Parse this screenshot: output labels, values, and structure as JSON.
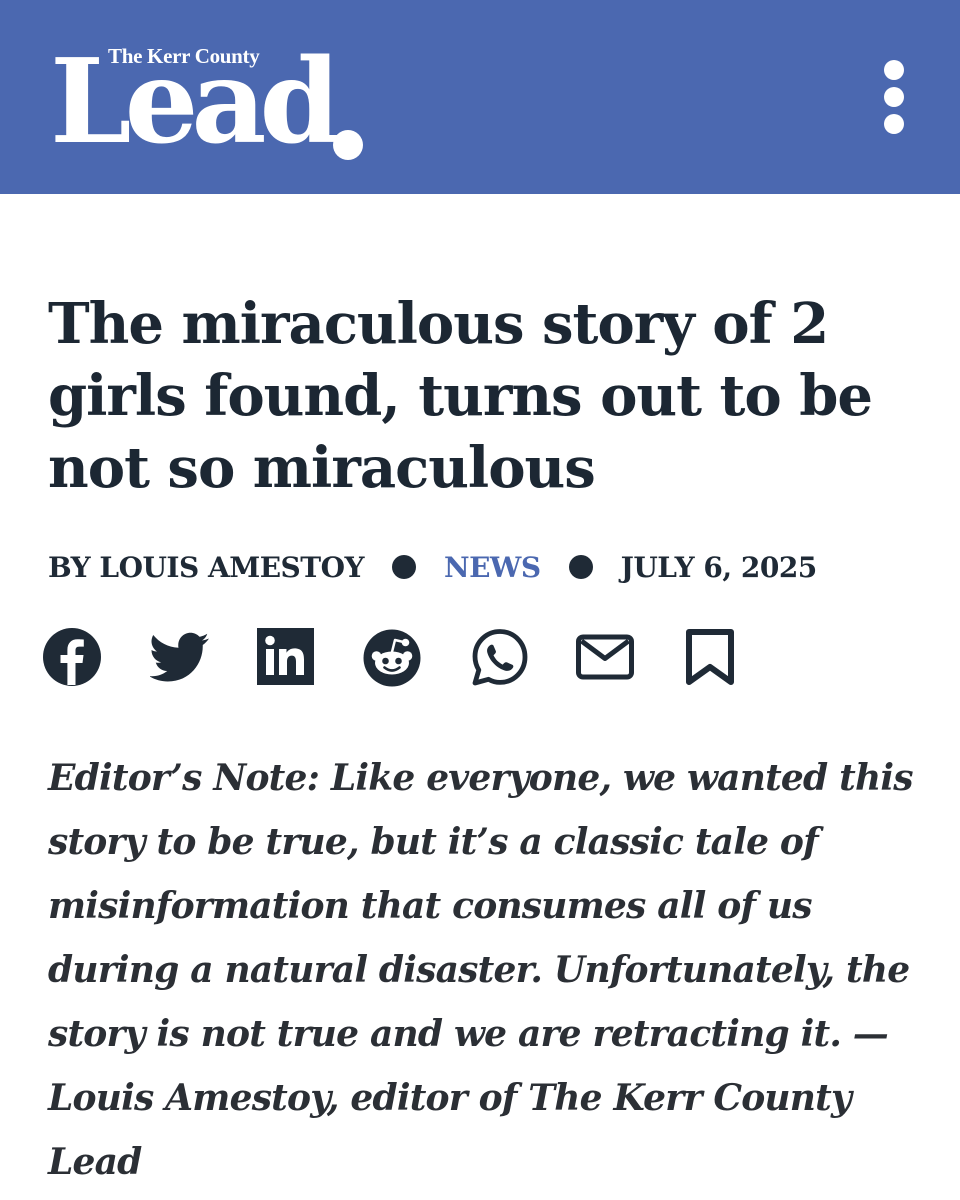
{
  "header": {
    "logo_small": "The Kerr County",
    "logo_big": "Lead",
    "brand_color": "#4b68b0",
    "menu_icon": "more-vertical-icon"
  },
  "article": {
    "title": "The miraculous story of 2 girls found, turns out to be not so miraculous",
    "byline": "BY LOUIS AMESTOY",
    "category": "NEWS",
    "date": "JULY 6, 2025",
    "editor_note": "Editor’s Note: Like everyone, we wanted this story to be true, but it’s a classic tale of misinformation that consumes all of us during a natural disaster. Unfortunately, the story is not true and we are retracting it. — Louis Amestoy, editor of The Kerr County Lead"
  },
  "share_icons": [
    "facebook-icon",
    "twitter-icon",
    "linkedin-icon",
    "reddit-icon",
    "whatsapp-icon",
    "email-icon",
    "bookmark-icon"
  ],
  "colors": {
    "text": "#1c2733",
    "accent": "#4b68b0",
    "background": "#ffffff"
  }
}
